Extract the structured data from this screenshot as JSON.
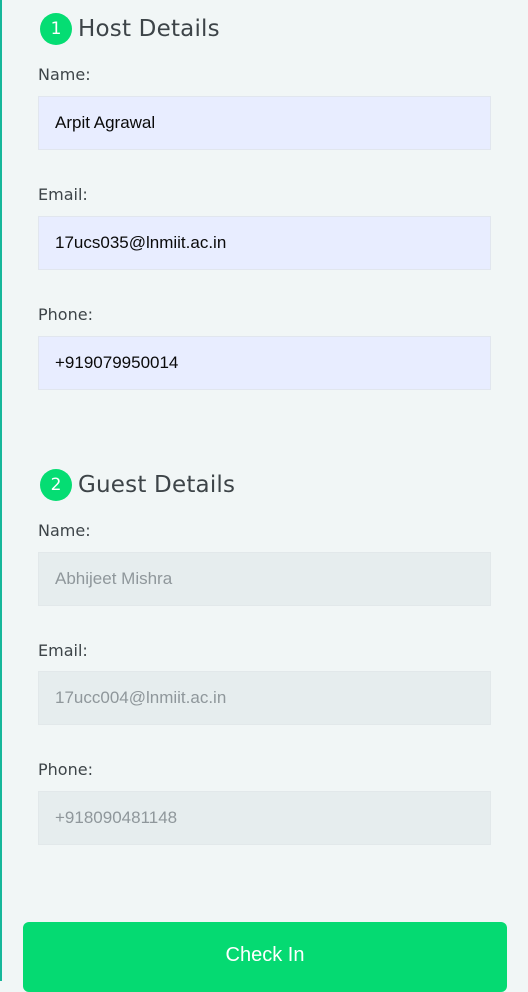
{
  "host": {
    "step": "1",
    "title": "Host Details",
    "name_label": "Name:",
    "name_value": "Arpit Agrawal",
    "email_label": "Email:",
    "email_value": "17ucs035@lnmiit.ac.in",
    "phone_label": "Phone:",
    "phone_value": "+919079950014"
  },
  "guest": {
    "step": "2",
    "title": "Guest Details",
    "name_label": "Name:",
    "name_placeholder": "Abhijeet Mishra",
    "email_label": "Email:",
    "email_placeholder": "17ucc004@lnmiit.ac.in",
    "phone_label": "Phone:",
    "phone_placeholder": "+918090481148"
  },
  "actions": {
    "checkin_label": "Check In"
  },
  "colors": {
    "accent": "#05da72",
    "host_field_bg": "#e8edff",
    "guest_field_bg": "#e6edee",
    "page_bg": "#f1f6f6"
  }
}
